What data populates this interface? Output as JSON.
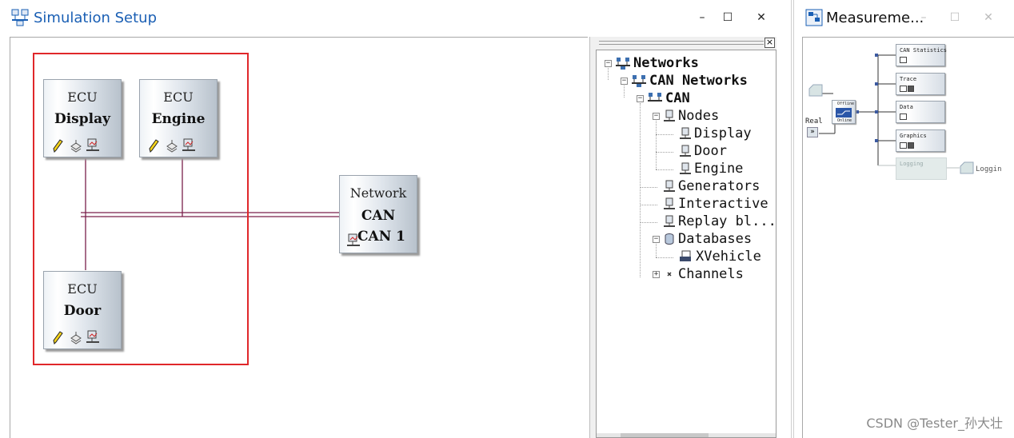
{
  "sim_window": {
    "title": "Simulation Setup",
    "controls": {
      "minimize": "–",
      "maximize": "☐",
      "close": "✕"
    }
  },
  "ecus": [
    {
      "type": "ECU",
      "name": "Display"
    },
    {
      "type": "ECU",
      "name": "Engine"
    },
    {
      "type": "ECU",
      "name": "Door"
    }
  ],
  "network": {
    "type": "Network",
    "bus": "CAN",
    "channel": "CAN 1"
  },
  "tree": {
    "root": "Networks",
    "can_networks": "CAN Networks",
    "can": "CAN",
    "nodes": "Nodes",
    "node_items": [
      "Display",
      "Door",
      "Engine"
    ],
    "generators": "Generators",
    "interactive": "Interactive",
    "replay": "Replay bl...",
    "databases": "Databases",
    "database_items": [
      "XVehicle"
    ],
    "channels": "Channels",
    "expand_minus": "−",
    "expand_plus": "+",
    "close_glyph": "×"
  },
  "meas_window": {
    "title": "Measureme...",
    "controls": {
      "minimize": "–",
      "maximize": "☐",
      "close": "✕"
    },
    "blocks": [
      "CAN Statistics",
      "Trace",
      "Data",
      "Graphics",
      "Logging"
    ],
    "real_label": "Real",
    "real_button": "»",
    "logging_tail": "Loggin",
    "offline_label": "Offline",
    "online_label": "Online"
  },
  "watermark": "CSDN @Tester_孙大壮",
  "colors": {
    "title_blue": "#1a5fb4",
    "highlight_red": "#e0272a",
    "bus_line": "#7a1f4a"
  }
}
